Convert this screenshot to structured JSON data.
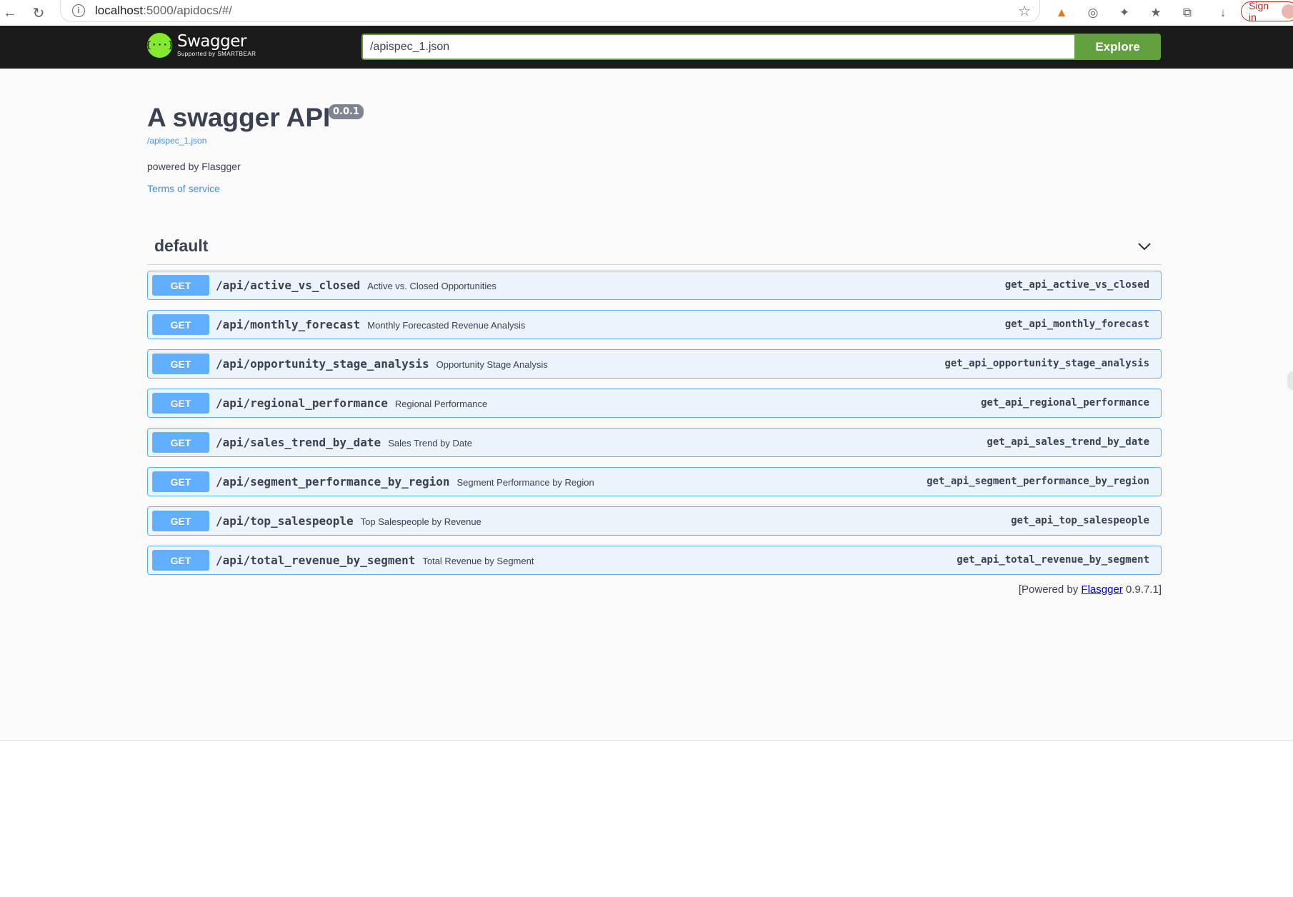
{
  "browser": {
    "url_host": "localhost",
    "url_rest": ":5000/apidocs/#/",
    "signin_label": "Sign in"
  },
  "topbar": {
    "brand": "Swagger",
    "brand_sub": "Supported by SMARTBEAR",
    "logo_glyph": "{···}",
    "spec_url": "/apispec_1.json",
    "explore_label": "Explore"
  },
  "info": {
    "title": "A swagger API",
    "version": "0.0.1",
    "spec_link": "/apispec_1.json",
    "description": "powered by Flasgger",
    "terms_label": "Terms of service"
  },
  "tag": {
    "name": "default"
  },
  "operations": [
    {
      "method": "GET",
      "path": "/api/active_vs_closed",
      "summary": "Active vs. Closed Opportunities",
      "op_id": "get_api_active_vs_closed"
    },
    {
      "method": "GET",
      "path": "/api/monthly_forecast",
      "summary": "Monthly Forecasted Revenue Analysis",
      "op_id": "get_api_monthly_forecast"
    },
    {
      "method": "GET",
      "path": "/api/opportunity_stage_analysis",
      "summary": "Opportunity Stage Analysis",
      "op_id": "get_api_opportunity_stage_analysis"
    },
    {
      "method": "GET",
      "path": "/api/regional_performance",
      "summary": "Regional Performance",
      "op_id": "get_api_regional_performance"
    },
    {
      "method": "GET",
      "path": "/api/sales_trend_by_date",
      "summary": "Sales Trend by Date",
      "op_id": "get_api_sales_trend_by_date"
    },
    {
      "method": "GET",
      "path": "/api/segment_performance_by_region",
      "summary": "Segment Performance by Region",
      "op_id": "get_api_segment_performance_by_region"
    },
    {
      "method": "GET",
      "path": "/api/top_salespeople",
      "summary": "Top Salespeople by Revenue",
      "op_id": "get_api_top_salespeople"
    },
    {
      "method": "GET",
      "path": "/api/total_revenue_by_segment",
      "summary": "Total Revenue by Segment",
      "op_id": "get_api_total_revenue_by_segment"
    }
  ],
  "footer": {
    "prefix": "[Powered by ",
    "link": "Flasgger",
    "suffix": " 0.9.7.1]"
  },
  "colors": {
    "get_method": "#61affe",
    "get_bg": "#ebf3fb",
    "topbar_bg": "#1b1b1b",
    "swagger_green": "#62a03f",
    "logo_green": "#85ea2d"
  }
}
